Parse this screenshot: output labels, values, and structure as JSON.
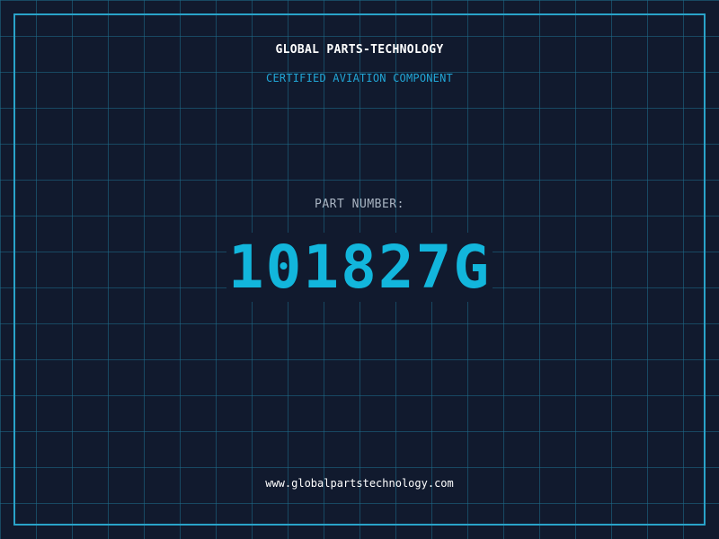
{
  "header": {
    "company_name": "GLOBAL PARTS-TECHNOLOGY",
    "subtitle": "CERTIFIED AVIATION COMPONENT"
  },
  "part": {
    "label": "PART NUMBER:",
    "number": "101827G"
  },
  "footer": {
    "website": "www.globalpartstechnology.com"
  },
  "colors": {
    "background": "#111a2e",
    "grid": "#1e6e8c",
    "frame": "#29a3c9",
    "accent": "#12b6dc",
    "title": "#ffffff",
    "label": "#a9b4c2"
  }
}
